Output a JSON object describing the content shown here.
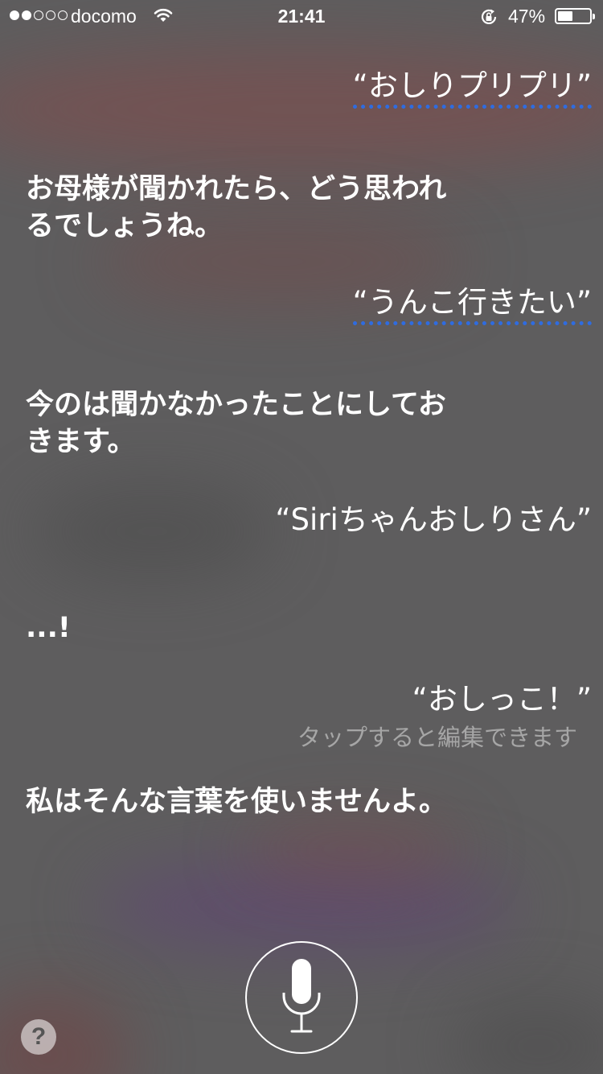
{
  "status_bar": {
    "carrier": "docomo",
    "time": "21:41",
    "battery_percent": "47%",
    "battery_level": 0.47,
    "signal_bars_filled": 2,
    "signal_bars_total": 5,
    "icons": [
      "wifi-icon",
      "rotation-lock-icon",
      "battery-icon"
    ]
  },
  "conversation": [
    {
      "speaker": "user",
      "text": "“おしりプリプリ”",
      "underlined": true
    },
    {
      "speaker": "siri",
      "text": "お母様が聞かれたら、どう思われるでしょうね。"
    },
    {
      "speaker": "user",
      "text": "“うんこ行きたい”",
      "underlined": true
    },
    {
      "speaker": "siri",
      "text": "今のは聞かなかったことにしておきます。"
    },
    {
      "speaker": "user",
      "text": "“Siriちゃんおしりさん”",
      "underlined": false
    },
    {
      "speaker": "siri",
      "text": "...!"
    },
    {
      "speaker": "user",
      "text": "“おしっこ！”",
      "underlined": false
    },
    {
      "speaker": "siri",
      "text": "私はそんな言葉を使いませんよ。"
    }
  ],
  "edit_hint": "タップすると編集できます",
  "controls": {
    "mic_icon": "microphone-icon",
    "help_label": "?"
  },
  "colors": {
    "underline": "#2f6ce0",
    "text": "#ffffff",
    "hint_text": "rgba(255,255,255,0.45)"
  }
}
